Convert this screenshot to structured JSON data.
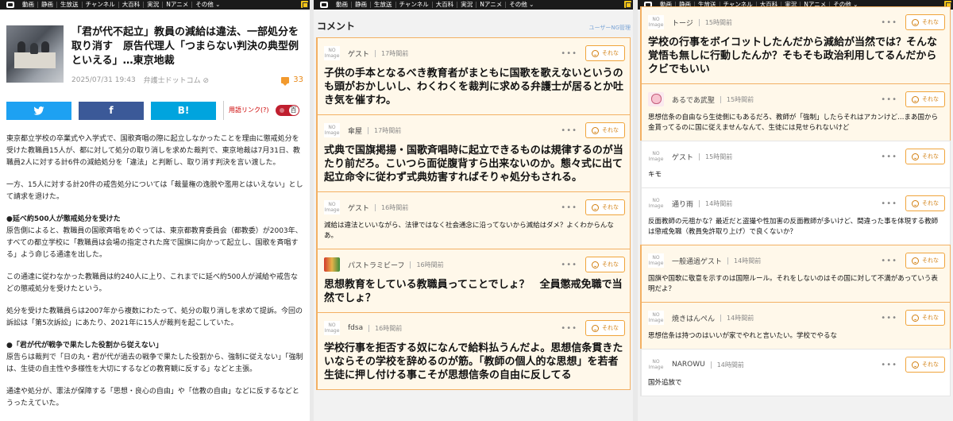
{
  "nav": {
    "items": [
      "動画",
      "静画",
      "生放送",
      "チャンネル",
      "大百科",
      "実況",
      "Nアニメ",
      "その他"
    ]
  },
  "article": {
    "title": "「君が代不起立」教員の減給は違法、一部処分を取り消す　原告代理人「つまらない判決の典型例といえる」…東京地裁",
    "date": "2025/07/31 19:43",
    "source": "弁護士ドットコム",
    "comment_count": "33",
    "share": {
      "twitter": "",
      "facebook": "f",
      "hatena": "B!"
    },
    "keyword_link_label": "用語リンク(?)",
    "keyword_toggle": "百",
    "paragraphs": [
      "東京都立学校の卒業式や入学式で、国歌斉唱の際に起立しなかったことを理由に懲戒処分を受けた教職員15人が、都に対して処分の取り消しを求めた裁判で、東京地裁は7月31日、教職員2人に対する計6件の減給処分を「違法」と判断し、取り消す判決を言い渡した。",
      "一方、15人に対する計20件の戒告処分については「裁量権の逸脱や濫用とはいえない」として請求を退けた。"
    ],
    "section1_heading": "●延べ約500人が懲戒処分を受けた",
    "section1_paragraphs": [
      "原告側によると、教職員の国歌斉唱をめぐっては、東京都教育委員会（都教委）が2003年、すべての都立学校に「教職員は会場の指定された席で国旗に向かって起立し、国歌を斉唱する」よう命じる通達を出した。",
      "この通達に従わなかった教職員は約240人に上り、これまでに延べ約500人が減給や戒告などの懲戒処分を受けたという。",
      "処分を受けた教職員らは2007年から複数にわたって、処分の取り消しを求めて提訴。今回の訴訟は「第5次訴訟」にあたり、2021年に15人が裁判を起こしていた。"
    ],
    "section2_heading": "●「君が代が戦争で果たした役割から従えない」",
    "section2_paragraphs": [
      "原告らは裁判で「日の丸・君が代が過去の戦争で果たした役割から、強制に従えない」「強制は、生徒の自主性や多様性を大切にするなどの教育観に反する」などと主張。",
      "通達や処分が、憲法が保障する「思想・良心の自由」や「信教の自由」などに反するなどとうったえていた。"
    ]
  },
  "comments_panel": {
    "title": "コメント",
    "ng_label": "ユーザーNG管理",
    "sorena_label": "それな",
    "noimage_label": "NO Image",
    "more_label": "•••",
    "comments": [
      {
        "user": "ゲスト",
        "time": "17時間前",
        "avatar": "noimage",
        "big": true,
        "text": "子供の手本となるべき教育者がまともに国歌を歌えないというのも頭がおかしいし、わくわくを裁判に求める弁護士が居るとか吐き気を催すわ。"
      },
      {
        "user": "傘屋",
        "time": "17時間前",
        "avatar": "noimage",
        "big": true,
        "text": "式典で国旗掲揚・国歌斉唱時に起立できるものは規律するのが当たり前だろ。こいつら面従腹背すら出来ないのか。態々式に出て起立命令に従わず式典妨害すればそりゃ処分もされる。"
      },
      {
        "user": "ゲスト",
        "time": "16時間前",
        "avatar": "noimage",
        "big": false,
        "text": "減給は違法といいながら、法律ではなく社会通念に沿ってないから減給はダメ？よくわからんなあ。"
      },
      {
        "user": "パストラミビーフ",
        "time": "16時間前",
        "avatar": "beef",
        "big": true,
        "text": "思想教育をしている教職員ってことでしょ？　全員懲戒免職で当然でしょ？"
      },
      {
        "user": "fdsa",
        "time": "16時間前",
        "avatar": "noimage",
        "big": true,
        "text": "学校行事を拒否する奴になんで給料払うんだよ。思想信条貫きたいならその学校を辞めるのが筋。「教師の個人的な思想」を若者生徒に押し付ける事こそが思想信条の自由に反してる"
      }
    ]
  },
  "comments_panel2": {
    "comments": [
      {
        "user": "トージ",
        "time": "15時間前",
        "avatar": "noimage",
        "big": true,
        "plain": false,
        "text": "学校の行事をボイコットしたんだから減給が当然では？そんな覚悟も無しに行動したんか？そもそも政治利用してるんだからクビでもいい"
      },
      {
        "user": "あるであ武聖",
        "time": "15時間前",
        "avatar": "anime",
        "big": false,
        "plain": false,
        "text": "思想信条の自由なら生徒側にもあるだろ、教師が「強制」したらそれはアカンけど…まあ国から金貰ってるのに国に従えませんなんて、生徒には見せられないけど"
      },
      {
        "user": "ゲスト",
        "time": "15時間前",
        "avatar": "noimage",
        "big": false,
        "plain": true,
        "text": "キモ"
      },
      {
        "user": "通り雨",
        "time": "14時間前",
        "avatar": "noimage",
        "big": false,
        "plain": true,
        "text": "反面教師の元祖かな？最近だと盗撮や性加害の反面教師が多いけど、間違った事を体現する教師は懲戒免職（教員免許取り上げ）で良くないか？"
      },
      {
        "user": "一般通過ゲスト",
        "time": "14時間前",
        "avatar": "noimage",
        "big": false,
        "plain": false,
        "text": "国旗や国歌に敬意を示すのは国際ルール。それをしないのはその国に対して不満があっていう表明だよ？"
      },
      {
        "user": "焼きはんぺん",
        "time": "14時間前",
        "avatar": "noimage",
        "big": false,
        "plain": false,
        "text": "思想信条は持つのはいいが家でやれと言いたい。学校でやるな"
      },
      {
        "user": "NAROWU",
        "time": "14時間前",
        "avatar": "noimage",
        "big": false,
        "plain": true,
        "text": "国外追放で"
      }
    ]
  }
}
